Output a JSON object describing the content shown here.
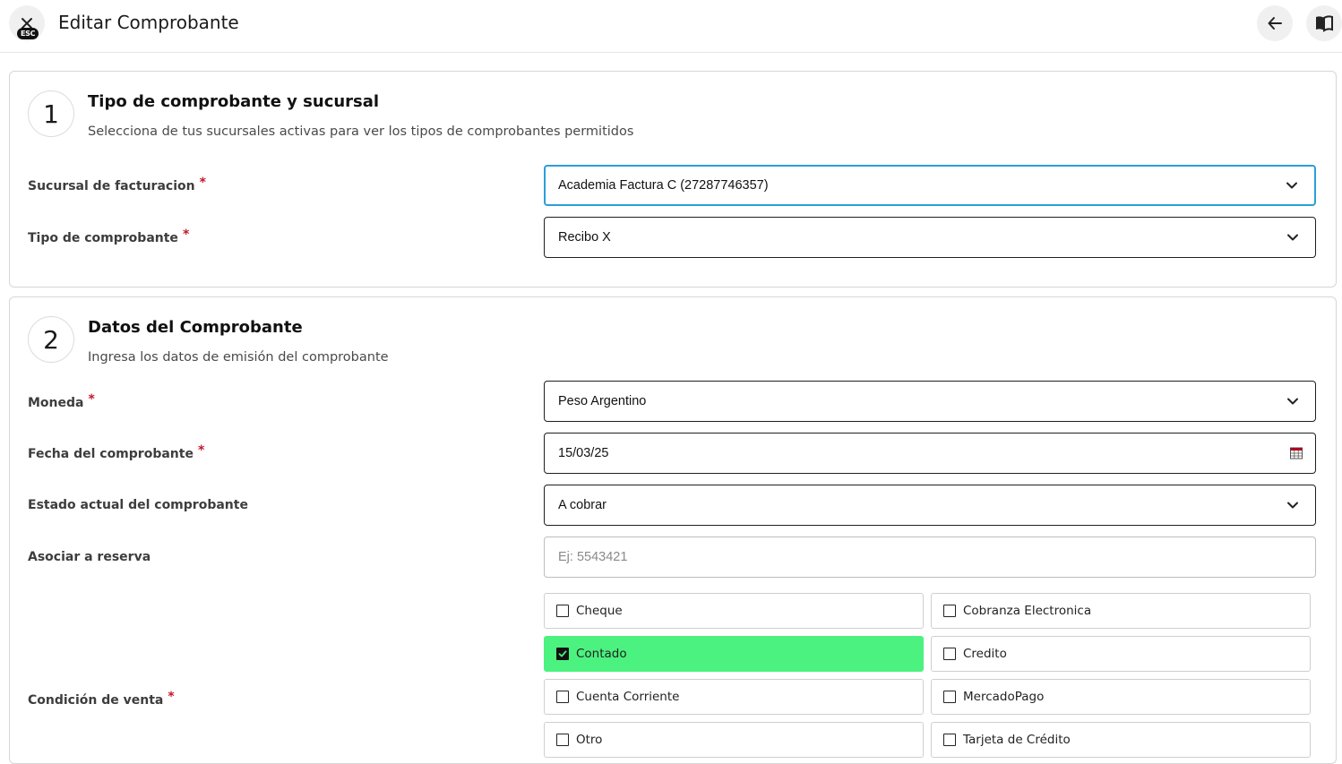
{
  "header": {
    "title": "Editar Comprobante",
    "esc_badge": "ESC",
    "close_icon": "close-icon",
    "back_icon": "arrow-left-icon",
    "help_icon": "book-open-icon"
  },
  "section1": {
    "number": "1",
    "title": "Tipo de comprobante y sucursal",
    "subtitle": "Selecciona de tus sucursales activas para ver los tipos de comprobantes permitidos",
    "fields": {
      "sucursal": {
        "label": "Sucursal de facturacion",
        "required_mark": "*",
        "value": "Academia Factura C (27287746357)"
      },
      "tipo": {
        "label": "Tipo de comprobante",
        "required_mark": "*",
        "value": "Recibo X"
      }
    }
  },
  "section2": {
    "number": "2",
    "title": "Datos del Comprobante",
    "subtitle": "Ingresa los datos de emisión del comprobante",
    "fields": {
      "moneda": {
        "label": "Moneda",
        "required_mark": "*",
        "value": "Peso Argentino"
      },
      "fecha": {
        "label": "Fecha del comprobante",
        "required_mark": "*",
        "value": "15/03/25"
      },
      "estado": {
        "label": "Estado actual del comprobante",
        "value": "A cobrar"
      },
      "reserva": {
        "label": "Asociar a reserva",
        "placeholder": "Ej: 5543421"
      }
    },
    "condicion": {
      "label": "Condición de venta",
      "required_mark": "*",
      "options": [
        {
          "label": "Cheque",
          "checked": false
        },
        {
          "label": "Cobranza Electronica",
          "checked": false
        },
        {
          "label": "Contado",
          "checked": true
        },
        {
          "label": "Credito",
          "checked": false
        },
        {
          "label": "Cuenta Corriente",
          "checked": false
        },
        {
          "label": "MercadoPago",
          "checked": false
        },
        {
          "label": "Otro",
          "checked": false
        },
        {
          "label": "Tarjeta de Crédito",
          "checked": false
        }
      ]
    }
  },
  "colors": {
    "focus_border": "#2a9fd8",
    "checked_bg": "#4cf27f",
    "required": "#c0172d",
    "calendar_icon": "#b00020"
  }
}
